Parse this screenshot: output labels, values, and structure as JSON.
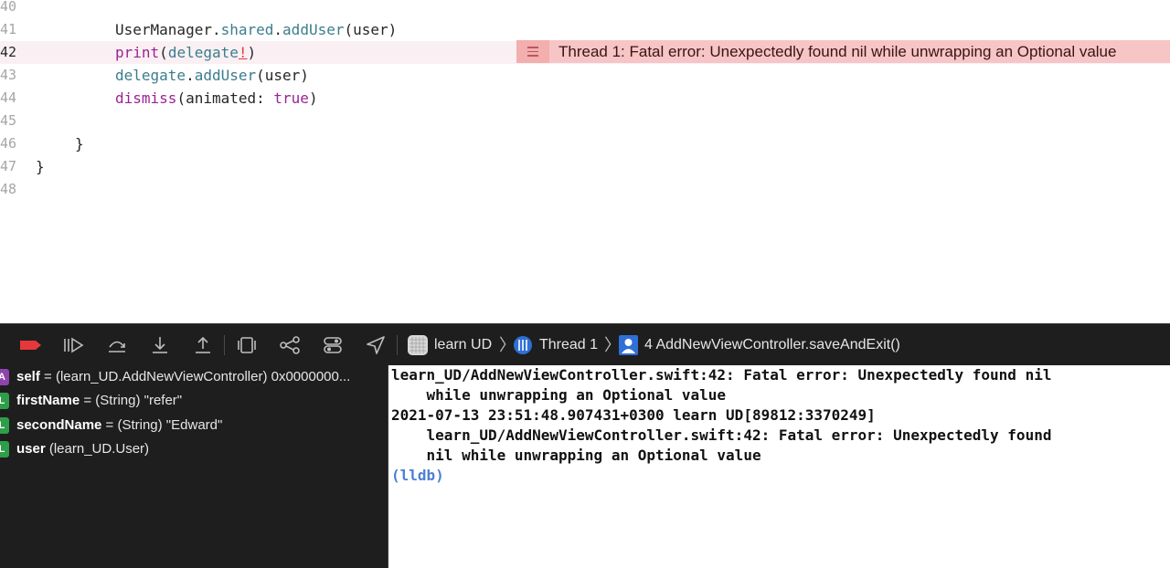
{
  "editor": {
    "lines": [
      {
        "num": "40"
      },
      {
        "num": "41",
        "indent": 1,
        "parts": [
          "UserManager",
          ".",
          "shared",
          ".",
          "addUser",
          "(user)"
        ]
      },
      {
        "num": "42",
        "indent": 1,
        "parts": [
          "print",
          "(",
          "delegate",
          "!",
          ")"
        ]
      },
      {
        "num": "43",
        "indent": 1,
        "parts": [
          "delegate",
          ".",
          "addUser",
          "(user)"
        ]
      },
      {
        "num": "44",
        "indent": 1,
        "parts": [
          "dismiss",
          "(animated: ",
          "true",
          ")"
        ]
      },
      {
        "num": "45"
      },
      {
        "num": "46",
        "brace": "}"
      },
      {
        "num": "47",
        "brace": "}"
      },
      {
        "num": "48"
      }
    ],
    "error_message": "Thread 1: Fatal error: Unexpectedly found nil while unwrapping an Optional value"
  },
  "debug_bar": {
    "app_name": "learn UD",
    "thread": "Thread 1",
    "frame": "4 AddNewViewController.saveAndExit()",
    "breakpoint_color": "#e5383b"
  },
  "variables": [
    {
      "badge": "A",
      "name": "self",
      "rest": " = (learn_UD.AddNewViewController) 0x0000000..."
    },
    {
      "badge": "L",
      "name": "firstName",
      "rest": " = (String) \"refer\""
    },
    {
      "badge": "L",
      "name": "secondName",
      "rest": " = (String) \"Edward\""
    },
    {
      "badge": "L",
      "name": "user",
      "rest": " (learn_UD.User)"
    }
  ],
  "console": {
    "lines": [
      "learn_UD/AddNewViewController.swift:42: Fatal error: Unexpectedly found nil",
      "    while unwrapping an Optional value",
      "2021-07-13 23:51:48.907431+0300 learn UD[89812:3370249]",
      "    learn_UD/AddNewViewController.swift:42: Fatal error: Unexpectedly found",
      "    nil while unwrapping an Optional value"
    ],
    "prompt": "(lldb)"
  }
}
